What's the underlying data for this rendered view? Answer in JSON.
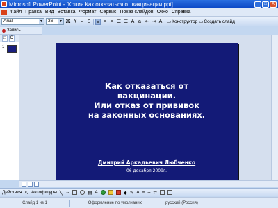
{
  "window": {
    "title": "Microsoft PowerPoint - [Копия Как отказаться от вакцинации.ppt]",
    "minimize": "_",
    "restore": "□",
    "close": "X"
  },
  "menu": [
    "Файл",
    "Правка",
    "Вид",
    "Вставка",
    "Формат",
    "Сервис",
    "Показ слайдов",
    "Окно",
    "Справка"
  ],
  "toolbar": {
    "font": "Arial",
    "size": "36",
    "bold": "Ж",
    "italic": "К",
    "underline": "Ч",
    "shadow": "S",
    "constructor": "Конструктор",
    "create_slide": "Создать слайд"
  },
  "record_toolbar": {
    "label": "Запись"
  },
  "outline_tabs": {
    "slides_tab": "□",
    "outline_tab": "С"
  },
  "thumbnails": [
    {
      "number": "1"
    }
  ],
  "slide": {
    "title_lines": [
      "Как отказаться от",
      "вакцинации.",
      "Или отказ от прививок",
      "на законных основаниях."
    ],
    "author": "Дмитрий Аркадьевич Любченко",
    "date": "06 декабря 2009г."
  },
  "draw_toolbar": {
    "draw": "Действия",
    "autoshapes": "Автофигуры"
  },
  "status": {
    "slide": "Слайд 1 из 1",
    "design": "Оформление по умолчанию",
    "language": "русский (Россия)"
  },
  "colors": {
    "slide_background": "#131a77",
    "titlebar": "#0a46c4"
  }
}
